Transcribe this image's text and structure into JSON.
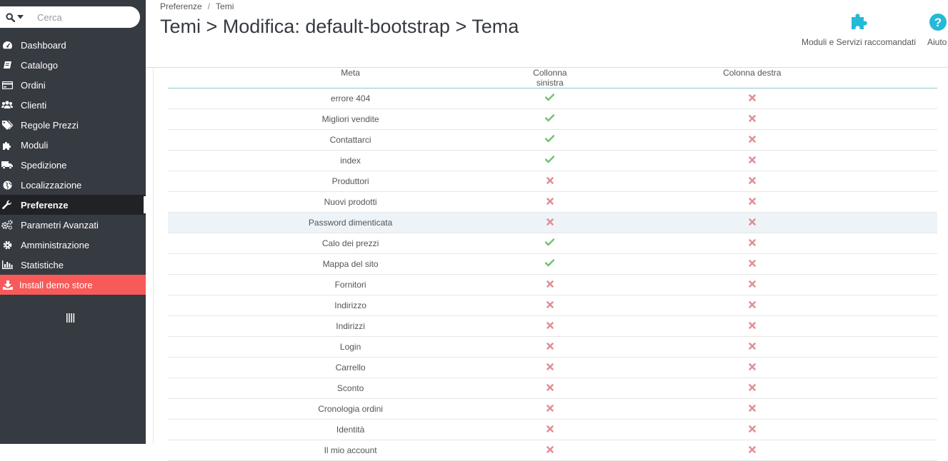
{
  "search": {
    "placeholder": "Cerca",
    "icon": "search-icon"
  },
  "sidebar": {
    "items": [
      {
        "label": "Dashboard",
        "icon": "dashboard-icon"
      },
      {
        "label": "Catalogo",
        "icon": "book-icon"
      },
      {
        "label": "Ordini",
        "icon": "credit-card-icon"
      },
      {
        "label": "Clienti",
        "icon": "users-icon"
      },
      {
        "label": "Regole Prezzi",
        "icon": "tags-icon"
      },
      {
        "label": "Moduli",
        "icon": "puzzle-icon"
      },
      {
        "label": "Spedizione",
        "icon": "truck-icon"
      },
      {
        "label": "Localizzazione",
        "icon": "globe-icon"
      },
      {
        "label": "Preferenze",
        "icon": "wrench-icon",
        "active": true
      },
      {
        "label": "Parametri Avanzati",
        "icon": "cogs-icon"
      },
      {
        "label": "Amministrazione",
        "icon": "cog-icon"
      },
      {
        "label": "Statistiche",
        "icon": "bar-chart-icon"
      }
    ],
    "demo": {
      "label": "Install demo store",
      "icon": "download-icon",
      "color": "#f85a5a"
    },
    "collapse_icon": "collapse-bars-icon"
  },
  "breadcrumb": {
    "parent": "Preferenze",
    "separator": "/",
    "current": "Temi"
  },
  "page_title": "Temi > Modifica: default-bootstrap > Tema",
  "toolbar": {
    "modules_label": "Moduli e Servizi raccomandati",
    "modules_icon": "puzzle-icon",
    "help_label": "Aiuto",
    "help_icon": "question-circle-icon"
  },
  "table": {
    "headers": {
      "meta": "Meta",
      "left": "Collonna sinistra",
      "right": "Colonna destra"
    },
    "rows": [
      {
        "meta": "errore 404",
        "left": true,
        "right": false
      },
      {
        "meta": "Migliori vendite",
        "left": true,
        "right": false
      },
      {
        "meta": "Contattarci",
        "left": true,
        "right": false
      },
      {
        "meta": "index",
        "left": true,
        "right": false
      },
      {
        "meta": "Produttori",
        "left": false,
        "right": false
      },
      {
        "meta": "Nuovi prodotti",
        "left": false,
        "right": false
      },
      {
        "meta": "Password dimenticata",
        "left": false,
        "right": false,
        "highlighted": true
      },
      {
        "meta": "Calo dei prezzi",
        "left": true,
        "right": false
      },
      {
        "meta": "Mappa del sito",
        "left": true,
        "right": false
      },
      {
        "meta": "Fornitori",
        "left": false,
        "right": false
      },
      {
        "meta": "Indirizzo",
        "left": false,
        "right": false
      },
      {
        "meta": "Indirizzi",
        "left": false,
        "right": false
      },
      {
        "meta": "Login",
        "left": false,
        "right": false
      },
      {
        "meta": "Carrello",
        "left": false,
        "right": false
      },
      {
        "meta": "Sconto",
        "left": false,
        "right": false
      },
      {
        "meta": "Cronologia ordini",
        "left": false,
        "right": false
      },
      {
        "meta": "Identità",
        "left": false,
        "right": false
      },
      {
        "meta": "Il mio account",
        "left": false,
        "right": false
      }
    ],
    "check_color": "#72c279",
    "cross_color": "#e08f95"
  },
  "colors": {
    "sidebar_bg": "#363a41",
    "sidebar_active_bg": "#202226",
    "accent": "#25b9d7"
  }
}
